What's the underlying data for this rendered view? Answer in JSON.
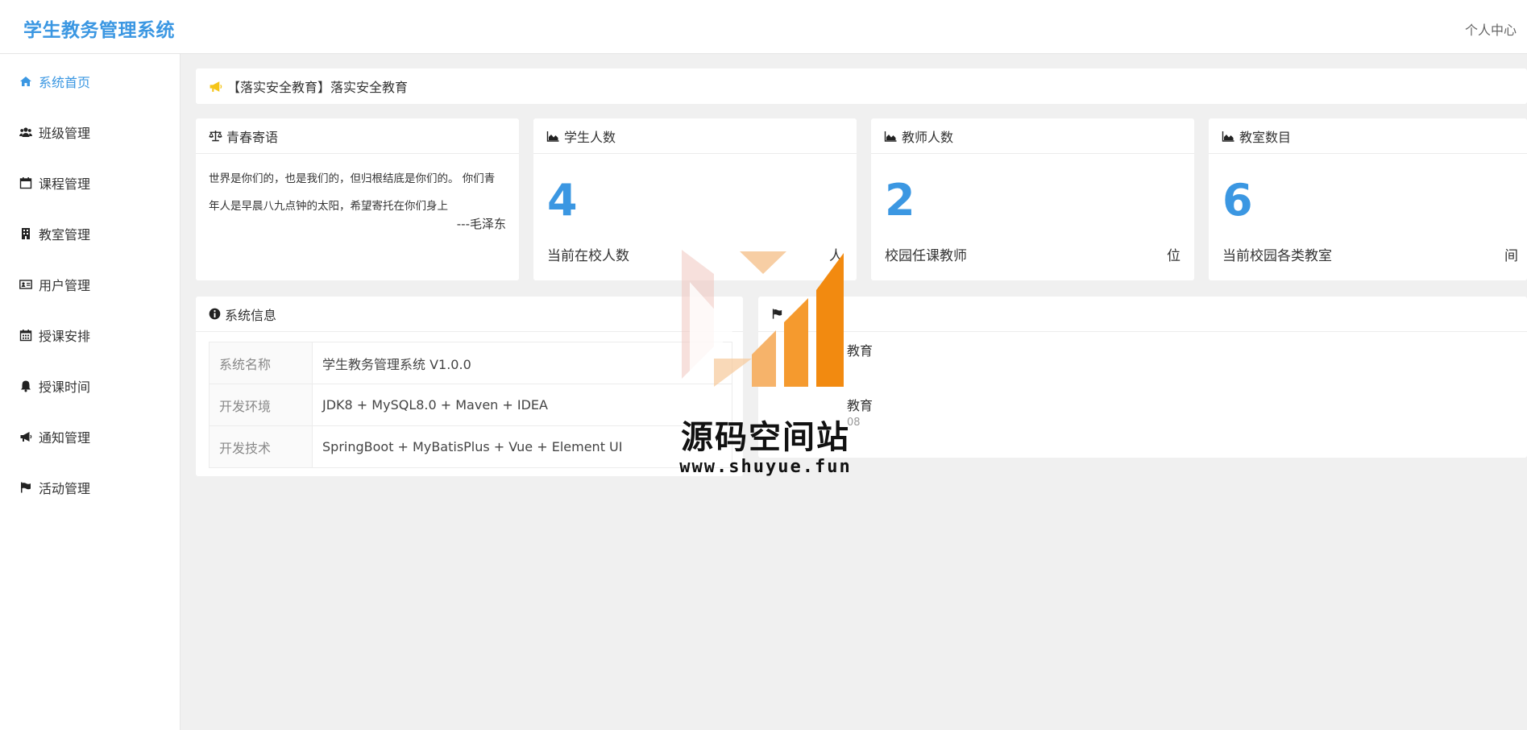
{
  "header": {
    "title": "学生教务管理系统",
    "user_center": "个人中心"
  },
  "colors": {
    "brand": "#3b97e2",
    "notice_icon": "#f5c518",
    "background": "#f0f0f0"
  },
  "sidebar": {
    "items": [
      {
        "label": "系统首页",
        "icon": "home-icon",
        "active": true
      },
      {
        "label": "班级管理",
        "icon": "users-icon"
      },
      {
        "label": "课程管理",
        "icon": "calendar-icon"
      },
      {
        "label": "教室管理",
        "icon": "building-icon"
      },
      {
        "label": "用户管理",
        "icon": "id-card-icon"
      },
      {
        "label": "授课安排",
        "icon": "calendar-grid-icon"
      },
      {
        "label": "授课时间",
        "icon": "bell-icon"
      },
      {
        "label": "通知管理",
        "icon": "megaphone-icon"
      },
      {
        "label": "活动管理",
        "icon": "flag-icon"
      }
    ]
  },
  "notice": {
    "text": "【落实安全教育】落实安全教育"
  },
  "quote_card": {
    "title": "青春寄语",
    "line1": "世界是你们的，也是我们的，但归根结底是你们的。 你们青",
    "line2": "年人是早晨八九点钟的太阳，希望寄托在你们身上",
    "author": "---毛泽东"
  },
  "stats": [
    {
      "title": "学生人数",
      "number": "4",
      "desc": "当前在校人数",
      "unit": "人"
    },
    {
      "title": "教师人数",
      "number": "2",
      "desc": "校园任课教师",
      "unit": "位"
    },
    {
      "title": "教室数目",
      "number": "6",
      "desc": "当前校园各类教室",
      "unit": "间"
    }
  ],
  "system_info": {
    "title": "系统信息",
    "rows": [
      {
        "key": "系统名称",
        "value": "学生教务管理系统 V1.0.0"
      },
      {
        "key": "开发环境",
        "value": "JDK8 + MySQL8.0 + Maven + IDEA"
      },
      {
        "key": "开发技术",
        "value": "SpringBoot + MyBatisPlus + Vue + Element UI"
      }
    ]
  },
  "activities": {
    "item1": "教育",
    "item2": "教育",
    "date2": "08"
  },
  "watermark": {
    "title": "源码空间站",
    "url": "www.shuyue.fun"
  }
}
